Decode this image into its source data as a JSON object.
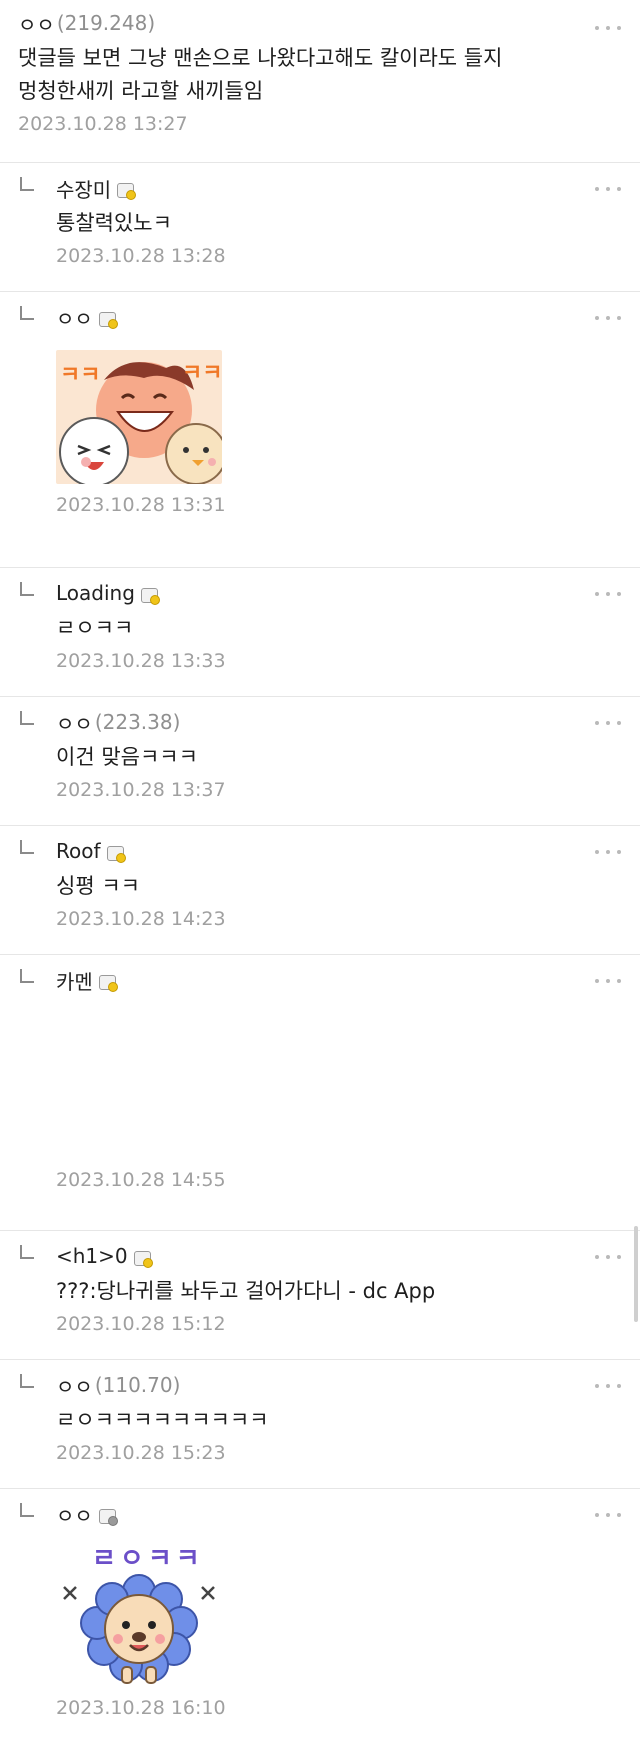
{
  "comments": [
    {
      "nick": "ㅇㅇ",
      "ip": "(219.248)",
      "text": "댓글들 보면 그냥 맨손으로 나왔다고해도 칼이라도 들지",
      "text2": "멍청한새끼 라고할 새끼들임",
      "date": "2023.10.28 13:27"
    },
    {
      "nick": "수장미",
      "text": "통찰력있노ㅋ",
      "date": "2023.10.28 13:28"
    },
    {
      "nick": "ㅇㅇ",
      "date": "2023.10.28 13:31"
    },
    {
      "nick": "Loading",
      "text": "ㄹㅇㅋㅋ",
      "date": "2023.10.28 13:33"
    },
    {
      "nick": "ㅇㅇ",
      "ip": "(223.38)",
      "text": "이건 맞음ㅋㅋㅋ",
      "date": "2023.10.28 13:37"
    },
    {
      "nick": "Roof",
      "text": "싱평 ㅋㅋ",
      "date": "2023.10.28 14:23"
    },
    {
      "nick": "카멘",
      "date": "2023.10.28 14:55"
    },
    {
      "nick": "<h1>0",
      "text": "???:당나귀를 놔두고 걸어가다니 - dc App",
      "date": "2023.10.28 15:12"
    },
    {
      "nick": "ㅇㅇ",
      "ip": "(110.70)",
      "text": "ㄹㅇㅋㅋㅋㅋㅋㅋㅋㅋㅋ",
      "date": "2023.10.28 15:23"
    },
    {
      "nick": "ㅇㅇ",
      "date": "2023.10.28 16:10"
    }
  ],
  "stickers": {
    "laugh_text": "ㅋㅋ",
    "lion_text": "ㄹㅇㅋㅋ"
  }
}
